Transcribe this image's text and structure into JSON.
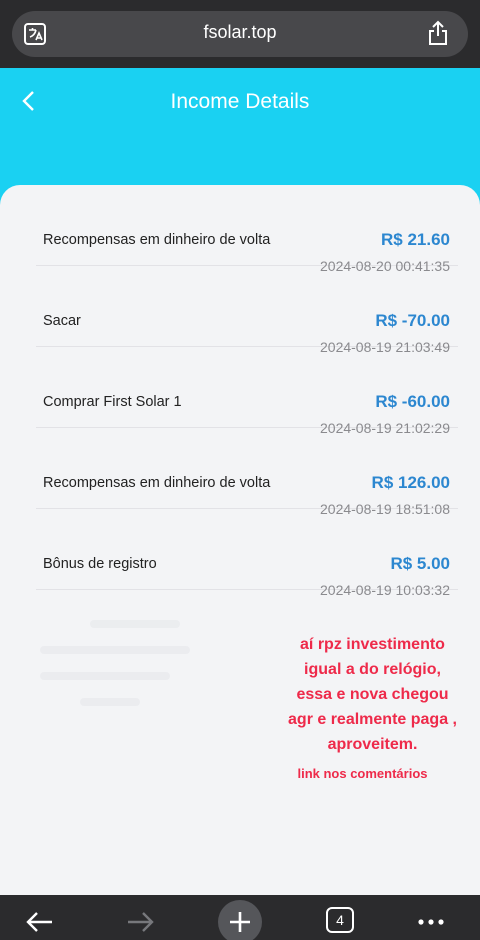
{
  "browser": {
    "url": "fsolar.top",
    "tab_count": "4"
  },
  "header": {
    "title": "Income Details"
  },
  "transactions": [
    {
      "label": "Recompensas em dinheiro de volta",
      "amount": "R$ 21.60",
      "time": "2024-08-20 00:41:35"
    },
    {
      "label": "Sacar",
      "amount": "R$ -70.00",
      "time": "2024-08-19 21:03:49"
    },
    {
      "label": "Comprar First Solar 1",
      "amount": "R$ -60.00",
      "time": "2024-08-19 21:02:29"
    },
    {
      "label": "Recompensas em dinheiro de volta",
      "amount": "R$ 126.00",
      "time": "2024-08-19 18:51:08"
    },
    {
      "label": "Bônus de registro",
      "amount": "R$ 5.00",
      "time": "2024-08-19 10:03:32"
    }
  ],
  "overlay": {
    "line1": "aí rpz investimento",
    "line2": "igual a do relógio,",
    "line3": "essa e nova chegou",
    "line4": "agr e realmente paga ,",
    "line5": "aproveitem.",
    "link_note": "link nos comentários"
  },
  "colors": {
    "header_bg": "#1ad1f2",
    "amount": "#2c87d0",
    "overlay_text": "#ee2a4a"
  },
  "icons": {
    "translate": "translate-icon",
    "share": "share-icon",
    "back": "chevron-left-icon",
    "nav_back": "arrow-left-icon",
    "nav_forward": "arrow-right-icon",
    "new_tab": "plus-icon",
    "menu": "more-dots-icon"
  }
}
